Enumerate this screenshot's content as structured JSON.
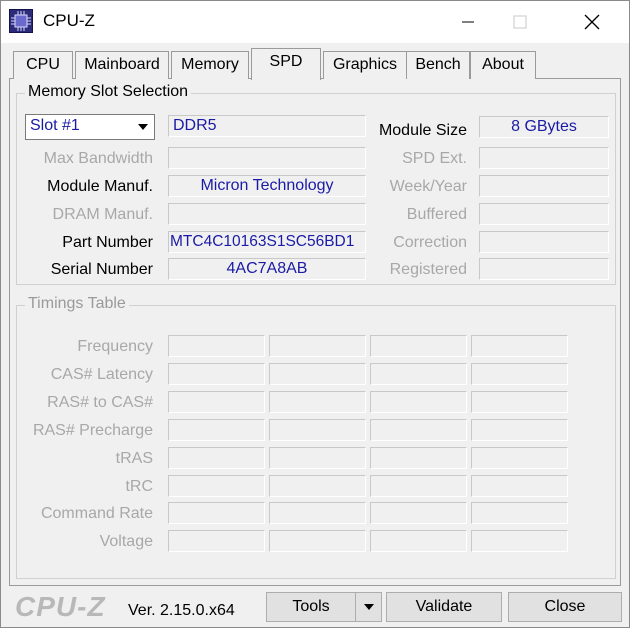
{
  "window": {
    "title": "CPU-Z",
    "icon": "cpu-z-app-icon",
    "controls": [
      "minimize-icon",
      "maximize-icon",
      "close-icon"
    ]
  },
  "tabs": [
    {
      "label": "CPU"
    },
    {
      "label": "Mainboard"
    },
    {
      "label": "Memory"
    },
    {
      "label": "SPD",
      "active": true
    },
    {
      "label": "Graphics"
    },
    {
      "label": "Bench"
    },
    {
      "label": "About"
    }
  ],
  "slot_selection": {
    "title": "Memory Slot Selection",
    "slot": "Slot #1",
    "type": "DDR5",
    "max_bandwidth_label": "Max Bandwidth",
    "max_bandwidth": "",
    "module_manuf_label": "Module Manuf.",
    "module_manuf": "Micron Technology",
    "dram_manuf_label": "DRAM Manuf.",
    "dram_manuf": "",
    "part_number_label": "Part Number",
    "part_number": "MTC4C10163S1SC56BD1",
    "serial_number_label": "Serial Number",
    "serial_number": "4AC7A8AB",
    "module_size_label": "Module Size",
    "module_size": "8 GBytes",
    "spd_ext_label": "SPD Ext.",
    "spd_ext": "",
    "week_year_label": "Week/Year",
    "week_year": "",
    "buffered_label": "Buffered",
    "buffered": "",
    "correction_label": "Correction",
    "correction": "",
    "registered_label": "Registered",
    "registered": ""
  },
  "timings": {
    "title": "Timings Table",
    "rows": [
      "Frequency",
      "CAS# Latency",
      "RAS# to CAS#",
      "RAS# Precharge",
      "tRAS",
      "tRC",
      "Command Rate",
      "Voltage"
    ]
  },
  "footer": {
    "brand": "CPU-Z",
    "version": "Ver. 2.15.0.x64",
    "tools_label": "Tools",
    "validate_label": "Validate",
    "close_label": "Close"
  },
  "colors": {
    "value_text": "#1a1aa6",
    "disabled_text": "#a8a8a8",
    "window_bg": "#f0f0f0"
  }
}
